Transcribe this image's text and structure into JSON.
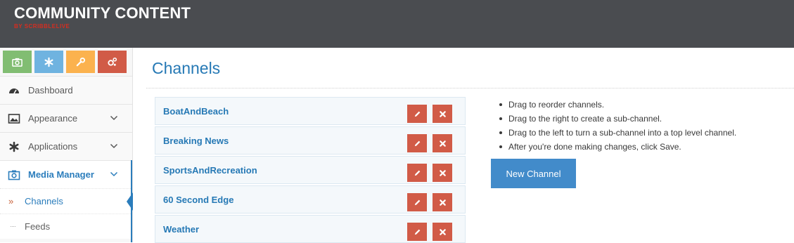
{
  "header": {
    "brand": "COMMUNITY CONTENT",
    "brand_sub": "BY SCRIBBLELIVE"
  },
  "sidebar": {
    "shortcut_buttons": [
      {
        "icon": "camera-icon",
        "color": "#81bd72"
      },
      {
        "icon": "asterisk-icon",
        "color": "#6fb3e0"
      },
      {
        "icon": "wrench-icon",
        "color": "#fbb24e"
      },
      {
        "icon": "cogs-icon",
        "color": "#d15b47"
      }
    ],
    "nav": [
      {
        "label": "Dashboard",
        "icon": "dashboard-icon"
      },
      {
        "label": "Appearance",
        "icon": "image-icon"
      },
      {
        "label": "Applications",
        "icon": "asterisk-icon"
      },
      {
        "label": "Media Manager",
        "icon": "camera-icon"
      }
    ],
    "sub_nav": [
      {
        "label": "Channels",
        "current": true
      },
      {
        "label": "Feeds",
        "current": false
      }
    ]
  },
  "main": {
    "title": "Channels",
    "channels": [
      {
        "name": "BoatAndBeach"
      },
      {
        "name": "Breaking News"
      },
      {
        "name": "SportsAndRecreation"
      },
      {
        "name": "60 Second Edge"
      },
      {
        "name": "Weather"
      }
    ],
    "help": [
      "Drag to reorder channels.",
      "Drag to the right to create a sub-channel.",
      "Drag to the left to turn a sub-channel into a top level channel.",
      "After you're done making changes, click Save."
    ],
    "new_channel_label": "New Channel"
  },
  "colors": {
    "header_bg": "#4a4c50",
    "accent_blue": "#2679b5",
    "danger": "#d15b47",
    "primary_button": "#428bca"
  }
}
